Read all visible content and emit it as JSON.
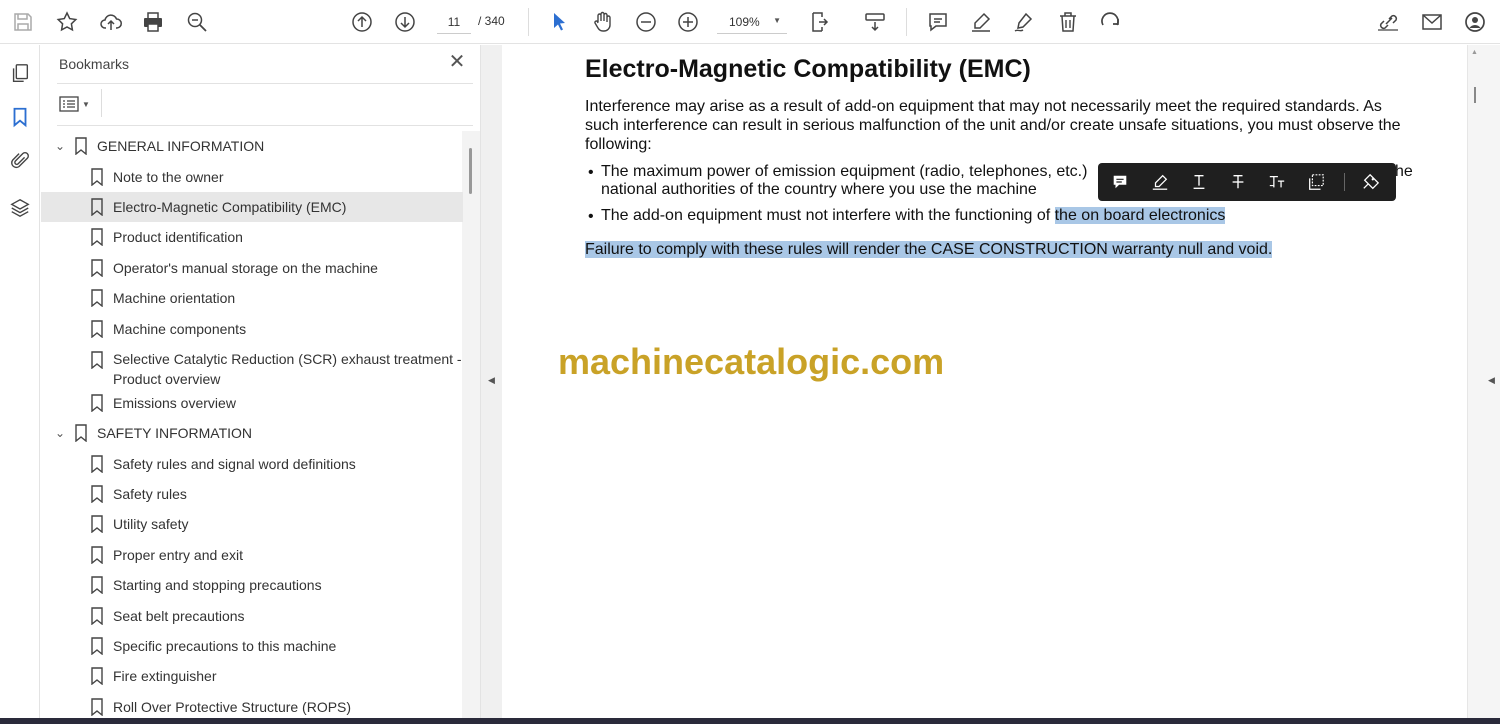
{
  "toolbar": {
    "page_current": "11",
    "page_total": "/ 340",
    "zoom": "109%",
    "icons": [
      "save-icon",
      "star-icon",
      "cloud-upload-icon",
      "print-icon",
      "zoom-search-icon",
      "page-up-icon",
      "page-down-icon",
      "select-cursor-icon",
      "hand-icon",
      "zoom-out-icon",
      "zoom-in-icon",
      "fit-page-icon",
      "scroll-mode-icon",
      "comment-icon",
      "highlight-icon",
      "sign-icon",
      "delete-icon",
      "rotate-icon",
      "share-link-icon",
      "email-icon",
      "account-icon"
    ]
  },
  "bookmarks": {
    "title": "Bookmarks",
    "close": "✕",
    "items": [
      {
        "label": "GENERAL INFORMATION",
        "level": 0
      },
      {
        "label": "Note to the owner",
        "level": 1
      },
      {
        "label": "Electro-Magnetic Compatibility (EMC)",
        "level": 1,
        "selected": true
      },
      {
        "label": "Product identification",
        "level": 1
      },
      {
        "label": "Operator's manual storage on the machine",
        "level": 1
      },
      {
        "label": "Machine orientation",
        "level": 1
      },
      {
        "label": "Machine components",
        "level": 1
      },
      {
        "label": "Selective Catalytic Reduction (SCR) exhaust treatment - Product overview",
        "level": 1
      },
      {
        "label": "Emissions overview",
        "level": 1
      },
      {
        "label": "SAFETY INFORMATION",
        "level": 0
      },
      {
        "label": "Safety rules and signal word definitions",
        "level": 1
      },
      {
        "label": "Safety rules",
        "level": 1
      },
      {
        "label": "Utility safety",
        "level": 1
      },
      {
        "label": "Proper entry and exit",
        "level": 1
      },
      {
        "label": "Starting and stopping precautions",
        "level": 1
      },
      {
        "label": "Seat belt precautions",
        "level": 1
      },
      {
        "label": "Specific precautions to this machine",
        "level": 1
      },
      {
        "label": "Fire extinguisher",
        "level": 1
      },
      {
        "label": "Roll Over Protective Structure (ROPS)",
        "level": 1
      }
    ]
  },
  "document": {
    "heading": "Electro-Magnetic Compatibility (EMC)",
    "intro": "Interference may arise as a result of add-on equipment that may not necessarily meet the required standards. As such interference can result in serious malfunction of the unit and/or create unsafe situations, you must observe the following:",
    "bullet1_line1": "The maximum power of emission equipment (radio, telephones, etc.)",
    "bullet1_tail": "he",
    "bullet1_line2": "national authorities of the country where you use the machine",
    "bullet2_plain": "The add-on equipment must not interfere with the functioning of ",
    "bullet2_highlight": "the on board electronics",
    "failure": "Failure to comply with these rules will render the CASE CONSTRUCTION warranty null and void.",
    "watermark": "machinecatalogic.com"
  },
  "colors": {
    "accent": "#2c6fd1",
    "selection": "#a9c7e6",
    "watermark": "#c9a227",
    "float_toolbar": "#1f1f1f"
  }
}
